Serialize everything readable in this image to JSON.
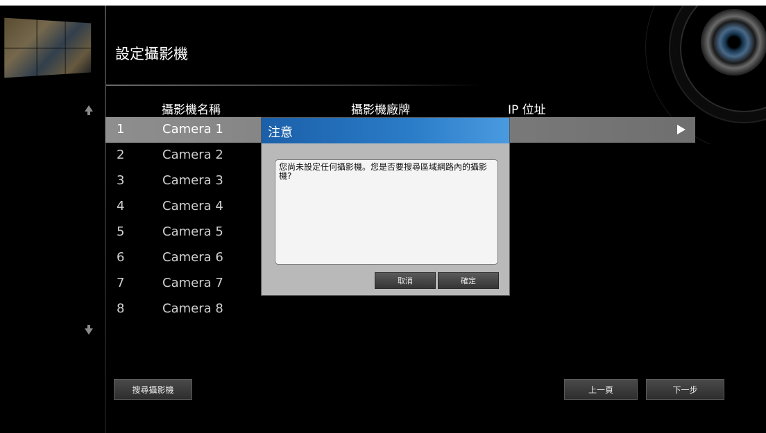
{
  "window": {
    "title": "設定攝影機"
  },
  "table": {
    "headers": {
      "name": "攝影機名稱",
      "brand": "攝影機廠牌",
      "ip": "IP 位址"
    },
    "rows": [
      {
        "num": "1",
        "name": "Camera 1"
      },
      {
        "num": "2",
        "name": "Camera 2"
      },
      {
        "num": "3",
        "name": "Camera 3"
      },
      {
        "num": "4",
        "name": "Camera 4"
      },
      {
        "num": "5",
        "name": "Camera 5"
      },
      {
        "num": "6",
        "name": "Camera 6"
      },
      {
        "num": "7",
        "name": "Camera 7"
      },
      {
        "num": "8",
        "name": "Camera 8"
      }
    ],
    "selected_index": 0
  },
  "buttons": {
    "search": "搜尋攝影機",
    "prev": "上一頁",
    "next": "下一步"
  },
  "dialog": {
    "title": "注意",
    "message": "您尚未設定任何攝影機。您是否要搜尋區域網路內的攝影機?",
    "cancel": "取消",
    "ok": "確定"
  },
  "icons": {
    "scroll_up": "arrow-up-icon",
    "scroll_down": "arrow-down-icon",
    "row_action": "play-icon",
    "logo": "camera-lens-icon"
  },
  "colors": {
    "dialog_header": "#2b7cc8",
    "selected_row": "#8e8e8e",
    "background": "#000000"
  }
}
